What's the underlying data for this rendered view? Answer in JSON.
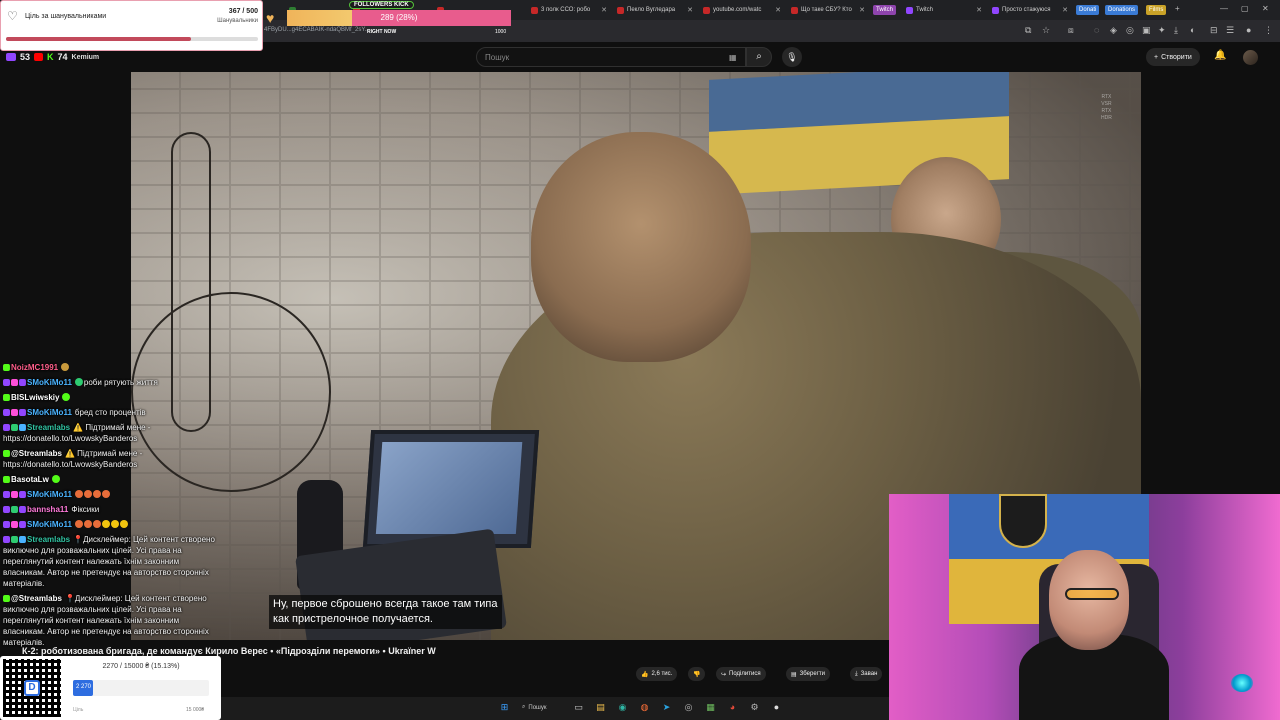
{
  "browser": {
    "tabs": [
      {
        "label": "",
        "color": "#2e7d32"
      },
      {
        "label": "",
        "color": "#c62828"
      },
      {
        "label": "",
        "color": "#c62828"
      },
      {
        "label": "3 полк ССО: робо",
        "color": "#c62828"
      },
      {
        "label": "Пекло Вугледара",
        "color": "#c62828"
      },
      {
        "label": "youtube.com/watc",
        "color": "#c62828"
      },
      {
        "label": "Що таке СБУ? Кто",
        "color": "#c62828"
      },
      {
        "label": "Twitch",
        "color": "#9146ff"
      },
      {
        "label": "Просто стажуюся",
        "color": "#9146ff"
      }
    ],
    "pills": [
      {
        "label": "Twitch",
        "color": "#8e44ad"
      },
      {
        "label": "Donati",
        "color": "#3a7bd5"
      },
      {
        "label": "Donations",
        "color": "#3a7bd5"
      },
      {
        "label": "Films",
        "color": "#c9a227"
      }
    ],
    "url": "4FByDU...g4ECABAIK-ndaQBMf_2sY...",
    "window_controls": [
      "—",
      "▢",
      "✕"
    ]
  },
  "youtube": {
    "search_placeholder": "Пошук",
    "create_label": "Створити",
    "video_title": "К-2: роботизована бригада, де командує Кирило Верес • «Підрозділи перемоги» • Ukraїner W",
    "subtitle_line1": "Ну, первое сброшено всегда такое там типа",
    "subtitle_line2": "как пристрелочное получается.",
    "rtx_line1": "RTX",
    "rtx_line2": "VSR",
    "rtx_line3": "RTX",
    "rtx_line4": "HDR",
    "actions": {
      "likes": "2,6 тис.",
      "share": "Поділитися",
      "save": "Зберегти",
      "download": "Заван"
    }
  },
  "overlay": {
    "goal": {
      "title": "Ціль за шанувальниками",
      "count": "367 / 500",
      "sub": "Шанувальники",
      "progress": 0.734
    },
    "kick": {
      "tag": "FOLLOWERS KICK",
      "value": "289 (28%)",
      "right_now": "RIGHT NOW",
      "max": "1000",
      "progress": 0.289
    },
    "viewers": {
      "twitch": "53",
      "kick": "74",
      "logo_text": "Kemium"
    },
    "donation": {
      "text": "2270 / 15000 ₴ (15.13%)",
      "fill_label": "2 270",
      "left_label": "Ціль",
      "right_label": "15 000₴",
      "progress": 0.15
    }
  },
  "chat": [
    {
      "user": "NoizMC1991",
      "color": "#ff5e8a",
      "badges": [
        "#53fc18"
      ],
      "text": "",
      "emotes": [
        "#c99a3c"
      ]
    },
    {
      "user": "SMoKiMo11",
      "color": "#4ab3ff",
      "badges": [
        "#9146ff",
        "#ff4fd8",
        "#9146ff"
      ],
      "text": "роби рятують життя",
      "emotes": [
        "#2ecc71"
      ]
    },
    {
      "user": "BISLwiwskiy",
      "color": "#ffffff",
      "badges": [
        "#53fc18"
      ],
      "text": "",
      "emotes": [
        "#53fc18"
      ]
    },
    {
      "user": "SMoKiMo11",
      "color": "#4ab3ff",
      "badges": [
        "#9146ff",
        "#ff4fd8",
        "#9146ff"
      ],
      "text": "бред сто процентів",
      "emotes": []
    },
    {
      "user": "Streamlabs",
      "color": "#31c3a2",
      "badges": [
        "#9146ff",
        "#2ecc71",
        "#4ab3ff"
      ],
      "text": "⚠️ Підтримай мене - https://donatello.to/LwowskyBanderos",
      "emotes": []
    },
    {
      "user": "@Streamlabs",
      "color": "#ffffff",
      "badges": [
        "#53fc18"
      ],
      "text": "⚠️ Підтримай мене - https://donatello.to/LwowskyBanderos",
      "emotes": []
    },
    {
      "user": "BasotaLw",
      "color": "#ffffff",
      "badges": [
        "#53fc18"
      ],
      "text": "",
      "emotes": [
        "#53fc18"
      ]
    },
    {
      "user": "SMoKiMo11",
      "color": "#4ab3ff",
      "badges": [
        "#9146ff",
        "#ff4fd8",
        "#9146ff"
      ],
      "text": "",
      "emotes": [
        "#e86d3a",
        "#e86d3a",
        "#e86d3a",
        "#e86d3a"
      ]
    },
    {
      "user": "bannsha11",
      "color": "#ff7ad9",
      "badges": [
        "#9146ff",
        "#2ecc71",
        "#9146ff"
      ],
      "text": "Фіксики",
      "emotes": []
    },
    {
      "user": "SMoKiMo11",
      "color": "#4ab3ff",
      "badges": [
        "#9146ff",
        "#ff4fd8",
        "#9146ff"
      ],
      "text": "",
      "emotes": [
        "#e86d3a",
        "#e86d3a",
        "#e86d3a",
        "#f1c40f",
        "#f1c40f",
        "#f1c40f"
      ]
    },
    {
      "user": "Streamlabs",
      "color": "#31c3a2",
      "badges": [
        "#9146ff",
        "#2ecc71",
        "#4ab3ff"
      ],
      "text": "📍Дисклеймер: Цей контент створено виключно для розважальних цілей. Усі права на переглянутий контент належать їхнім законним власникам. Автор не претендує на авторство сторонніх матеріалів.",
      "emotes": []
    },
    {
      "user": "@Streamlabs",
      "color": "#ffffff",
      "badges": [
        "#53fc18"
      ],
      "text": "📍Дисклеймер: Цей контент створено виключно для розважальних цілей. Усі права на переглянутий контент належать їхнім законним власникам. Автор не претендує на авторство сторонніх матеріалів.",
      "emotes": []
    }
  ],
  "taskbar": {
    "search_label": "Пошук",
    "icons": [
      {
        "name": "windows-start-icon",
        "glyph": "⊞",
        "color": "#3aa0ff"
      },
      {
        "name": "task-view-icon",
        "glyph": "▭",
        "color": "#cccccc"
      },
      {
        "name": "file-explorer-icon",
        "glyph": "▤",
        "color": "#f2c14e"
      },
      {
        "name": "edge-browser-icon",
        "glyph": "◉",
        "color": "#2fb6a5"
      },
      {
        "name": "firefox-icon",
        "glyph": "◍",
        "color": "#ff7139"
      },
      {
        "name": "telegram-icon",
        "glyph": "➤",
        "color": "#2aa3e0"
      },
      {
        "name": "media-player-icon",
        "glyph": "◎",
        "color": "#bbbbbb"
      },
      {
        "name": "app-icon",
        "glyph": "▦",
        "color": "#6fbf5f"
      },
      {
        "name": "chrome-icon",
        "glyph": "◕",
        "color": "#e84b3a"
      },
      {
        "name": "settings-icon",
        "glyph": "⚙",
        "color": "#bbbbbb"
      },
      {
        "name": "obs-icon",
        "glyph": "●",
        "color": "#dddddd"
      }
    ]
  }
}
